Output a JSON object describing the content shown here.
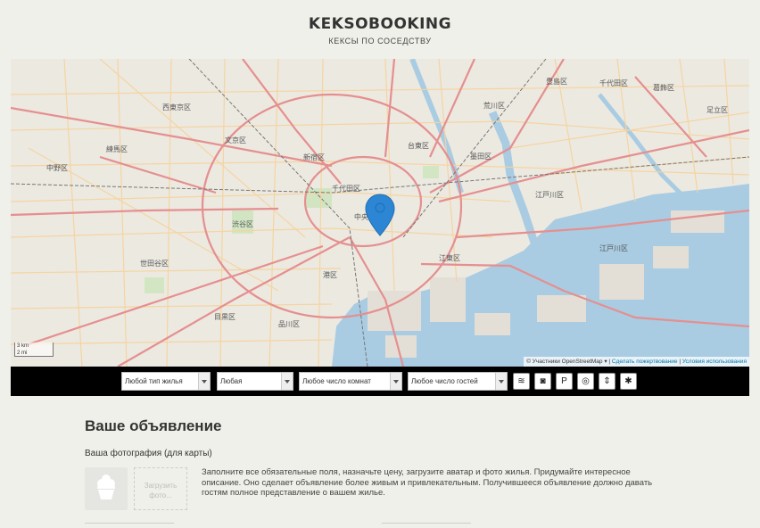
{
  "header": {
    "logo": "KEKSOBOOKING",
    "tagline": "КЕКСЫ ПО СОСЕДСТВУ"
  },
  "map": {
    "scale_label": "3 km",
    "scale_label_2": "2 mi",
    "attribution_prefix": "© Участники OpenStreetMap",
    "attribution_link_1": "Сделать пожертвование",
    "attribution_link_2": "Условия использования",
    "district_labels": [
      "西東京区",
      "豊島区",
      "千代田区",
      "練馬区",
      "文京区",
      "台東区",
      "中野区",
      "新宿区",
      "墨田区",
      "千代田区",
      "江戸川区",
      "渋谷区",
      "中央区",
      "江東区",
      "世田谷区",
      "港区",
      "目黒区",
      "品川区",
      "葛飾区",
      "荒川区",
      "足立区",
      "江戸川区"
    ],
    "colors": {
      "water": "#a9cce2",
      "land": "#ece9e1",
      "main_road": "#e58f8f",
      "minor_road": "#f6d39e",
      "pin": "#2d86d3"
    }
  },
  "filters": {
    "housing_type": "Любой тип жилья",
    "price": "Любая",
    "rooms": "Любое число комнат",
    "guests": "Любое число гостей",
    "features": [
      {
        "name": "wifi-icon",
        "glyph": "≋"
      },
      {
        "name": "dishwasher-icon",
        "glyph": "◙"
      },
      {
        "name": "parking-icon",
        "glyph": "P"
      },
      {
        "name": "washer-icon",
        "glyph": "◎"
      },
      {
        "name": "elevator-icon",
        "glyph": "⇕"
      },
      {
        "name": "conditioner-icon",
        "glyph": "✱"
      }
    ]
  },
  "form": {
    "title": "Ваше объявление",
    "photo_label": "Ваша фотография (для карты)",
    "upload_label": "Загрузить фото...",
    "hint": "Заполните все обязательные поля, назначьте цену, загрузите аватар и фото жилья. Придумайте интересное описание. Оно сделает объявление более живым и привлекательным. Получившееся объявление должно давать гостям полное представление о вашем жилье."
  }
}
